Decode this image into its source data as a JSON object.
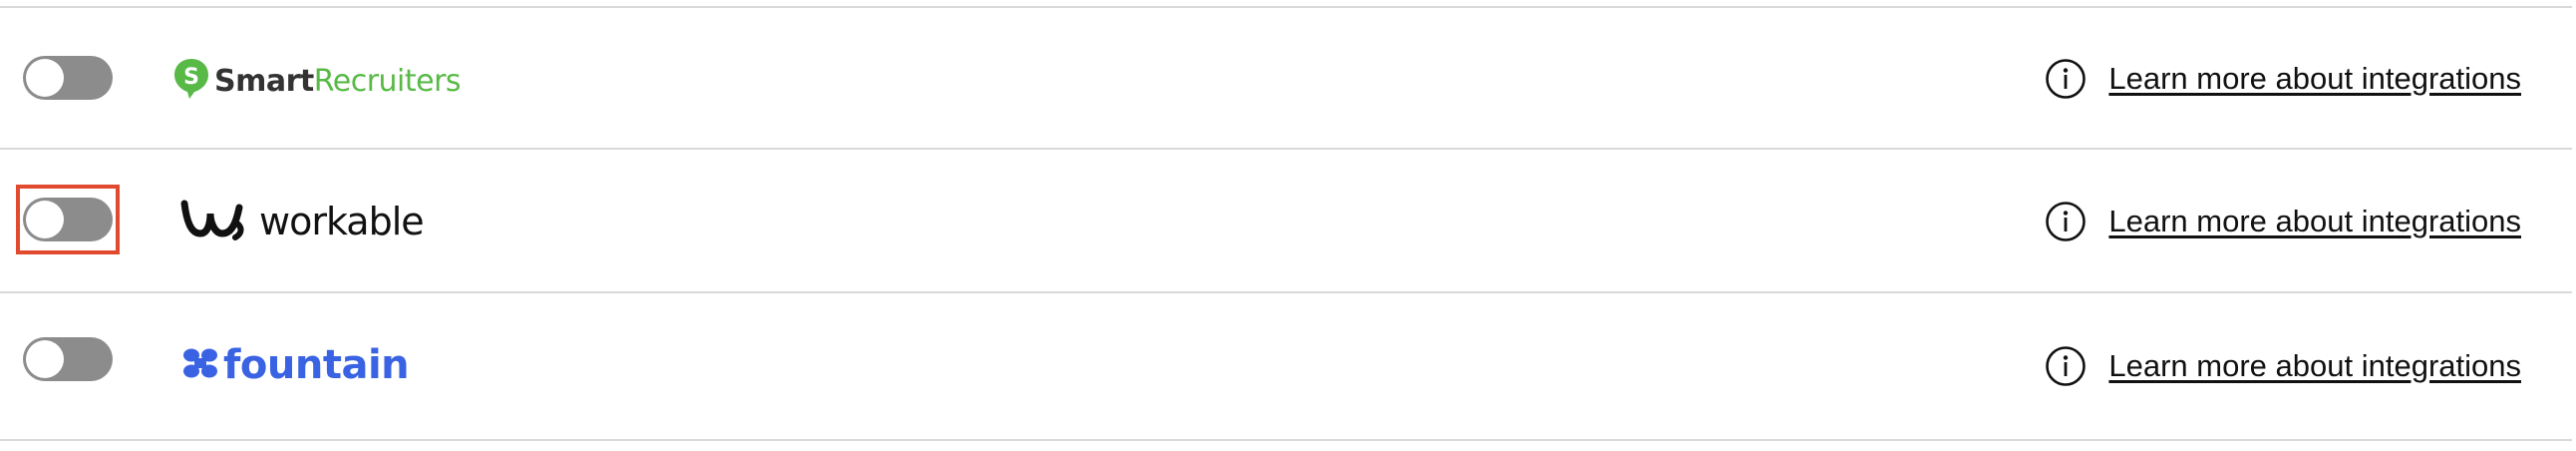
{
  "integrations": [
    {
      "name": "SmartRecruiters",
      "logo_text_primary": "Smart",
      "logo_text_secondary": "Recruiters",
      "enabled": false,
      "highlighted": false,
      "link_label": "Learn more about integrations"
    },
    {
      "name": "workable",
      "logo_text_primary": "workable",
      "enabled": false,
      "highlighted": true,
      "link_label": "Learn more about integrations"
    },
    {
      "name": "fountain",
      "logo_text_primary": "fountain",
      "enabled": false,
      "highlighted": false,
      "link_label": "Learn more about integrations"
    }
  ],
  "colors": {
    "toggle_off": "#8c8c8c",
    "highlight_box": "#e24a30",
    "smartrecruiters_green": "#58b947",
    "fountain_blue": "#3a63e4",
    "divider": "#d9d9d9"
  },
  "icons": {
    "info": "info-circle-icon",
    "smartrecruiters_mark": "smartrecruiters-logo-icon",
    "workable_mark": "workable-logo-icon",
    "fountain_mark": "fountain-logo-icon"
  }
}
